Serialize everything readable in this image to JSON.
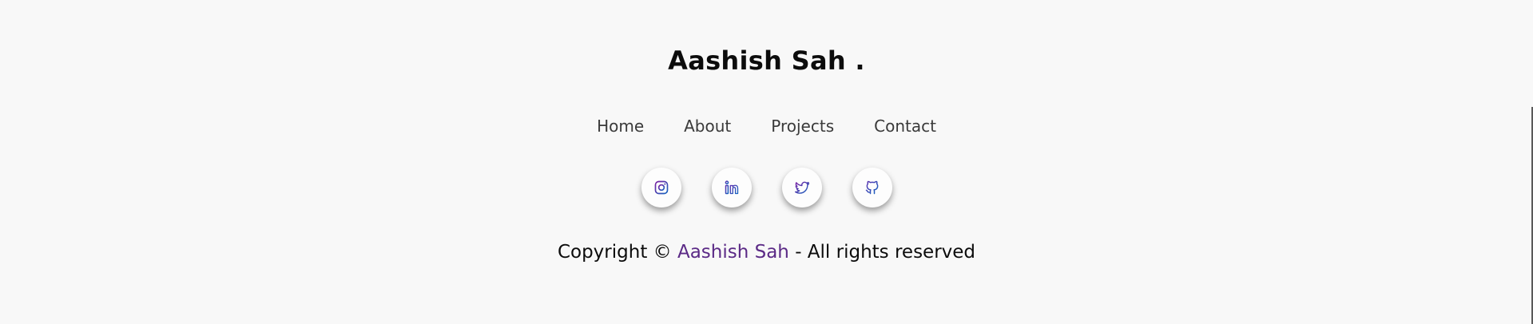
{
  "brand": {
    "name": "Aashish Sah ."
  },
  "nav": {
    "items": [
      {
        "label": "Home"
      },
      {
        "label": "About"
      },
      {
        "label": "Projects"
      },
      {
        "label": "Contact"
      }
    ]
  },
  "socials": [
    {
      "icon": "instagram-icon"
    },
    {
      "icon": "linkedin-icon"
    },
    {
      "icon": "twitter-icon"
    },
    {
      "icon": "github-icon"
    }
  ],
  "copyright": {
    "prefix": "Copyright © ",
    "name": "Aashish Sah",
    "suffix": " - All rights reserved"
  },
  "colors": {
    "background": "#f8f8f8",
    "accent": "#5b2a86",
    "icon_gradient_start": "#7b1fa2",
    "icon_gradient_end": "#1565c0"
  }
}
